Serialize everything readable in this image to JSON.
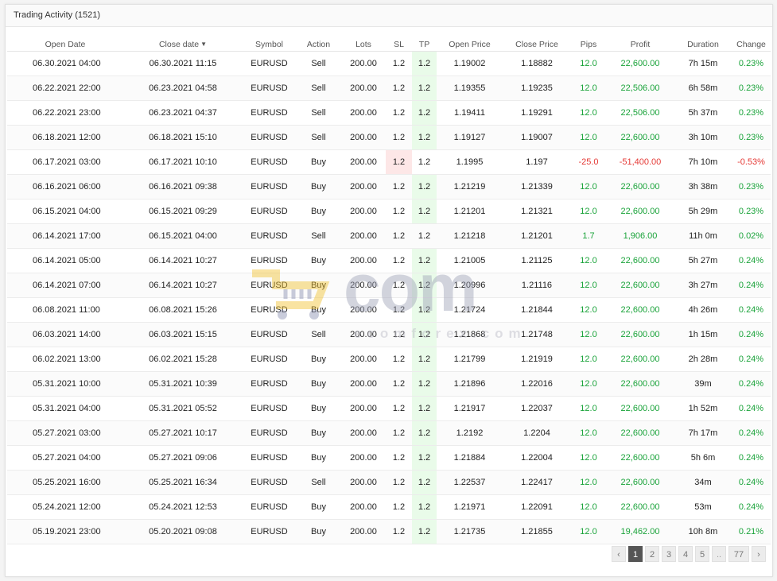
{
  "panel": {
    "title": "Trading Activity (1521)"
  },
  "table": {
    "columns": [
      "Open Date",
      "Close date",
      "Symbol",
      "Action",
      "Lots",
      "SL",
      "TP",
      "Open Price",
      "Close Price",
      "Pips",
      "Profit",
      "Duration",
      "Change"
    ],
    "sort_indicator": "▼",
    "rows": [
      {
        "open_date": "06.30.2021 04:00",
        "close_date": "06.30.2021 11:15",
        "symbol": "EURUSD",
        "action": "Sell",
        "lots": "200.00",
        "sl": "1.2",
        "tp": "1.2",
        "open_price": "1.19002",
        "close_price": "1.18882",
        "pips": "12.0",
        "profit": "22,600.00",
        "duration": "7h 15m",
        "change": "0.23%",
        "hl": "tp",
        "sign": "pos"
      },
      {
        "open_date": "06.22.2021 22:00",
        "close_date": "06.23.2021 04:58",
        "symbol": "EURUSD",
        "action": "Sell",
        "lots": "200.00",
        "sl": "1.2",
        "tp": "1.2",
        "open_price": "1.19355",
        "close_price": "1.19235",
        "pips": "12.0",
        "profit": "22,506.00",
        "duration": "6h 58m",
        "change": "0.23%",
        "hl": "tp",
        "sign": "pos"
      },
      {
        "open_date": "06.22.2021 23:00",
        "close_date": "06.23.2021 04:37",
        "symbol": "EURUSD",
        "action": "Sell",
        "lots": "200.00",
        "sl": "1.2",
        "tp": "1.2",
        "open_price": "1.19411",
        "close_price": "1.19291",
        "pips": "12.0",
        "profit": "22,506.00",
        "duration": "5h 37m",
        "change": "0.23%",
        "hl": "tp",
        "sign": "pos"
      },
      {
        "open_date": "06.18.2021 12:00",
        "close_date": "06.18.2021 15:10",
        "symbol": "EURUSD",
        "action": "Sell",
        "lots": "200.00",
        "sl": "1.2",
        "tp": "1.2",
        "open_price": "1.19127",
        "close_price": "1.19007",
        "pips": "12.0",
        "profit": "22,600.00",
        "duration": "3h 10m",
        "change": "0.23%",
        "hl": "tp",
        "sign": "pos"
      },
      {
        "open_date": "06.17.2021 03:00",
        "close_date": "06.17.2021 10:10",
        "symbol": "EURUSD",
        "action": "Buy",
        "lots": "200.00",
        "sl": "1.2",
        "tp": "1.2",
        "open_price": "1.1995",
        "close_price": "1.197",
        "pips": "-25.0",
        "profit": "-51,400.00",
        "duration": "7h 10m",
        "change": "-0.53%",
        "hl": "sl",
        "sign": "neg"
      },
      {
        "open_date": "06.16.2021 06:00",
        "close_date": "06.16.2021 09:38",
        "symbol": "EURUSD",
        "action": "Buy",
        "lots": "200.00",
        "sl": "1.2",
        "tp": "1.2",
        "open_price": "1.21219",
        "close_price": "1.21339",
        "pips": "12.0",
        "profit": "22,600.00",
        "duration": "3h 38m",
        "change": "0.23%",
        "hl": "tp",
        "sign": "pos"
      },
      {
        "open_date": "06.15.2021 04:00",
        "close_date": "06.15.2021 09:29",
        "symbol": "EURUSD",
        "action": "Buy",
        "lots": "200.00",
        "sl": "1.2",
        "tp": "1.2",
        "open_price": "1.21201",
        "close_price": "1.21321",
        "pips": "12.0",
        "profit": "22,600.00",
        "duration": "5h 29m",
        "change": "0.23%",
        "hl": "tp",
        "sign": "pos"
      },
      {
        "open_date": "06.14.2021 17:00",
        "close_date": "06.15.2021 04:00",
        "symbol": "EURUSD",
        "action": "Sell",
        "lots": "200.00",
        "sl": "1.2",
        "tp": "1.2",
        "open_price": "1.21218",
        "close_price": "1.21201",
        "pips": "1.7",
        "profit": "1,906.00",
        "duration": "11h 0m",
        "change": "0.02%",
        "hl": "none",
        "sign": "pos"
      },
      {
        "open_date": "06.14.2021 05:00",
        "close_date": "06.14.2021 10:27",
        "symbol": "EURUSD",
        "action": "Buy",
        "lots": "200.00",
        "sl": "1.2",
        "tp": "1.2",
        "open_price": "1.21005",
        "close_price": "1.21125",
        "pips": "12.0",
        "profit": "22,600.00",
        "duration": "5h 27m",
        "change": "0.24%",
        "hl": "tp",
        "sign": "pos"
      },
      {
        "open_date": "06.14.2021 07:00",
        "close_date": "06.14.2021 10:27",
        "symbol": "EURUSD",
        "action": "Buy",
        "lots": "200.00",
        "sl": "1.2",
        "tp": "1.2",
        "open_price": "1.20996",
        "close_price": "1.21116",
        "pips": "12.0",
        "profit": "22,600.00",
        "duration": "3h 27m",
        "change": "0.24%",
        "hl": "tp",
        "sign": "pos"
      },
      {
        "open_date": "06.08.2021 11:00",
        "close_date": "06.08.2021 15:26",
        "symbol": "EURUSD",
        "action": "Buy",
        "lots": "200.00",
        "sl": "1.2",
        "tp": "1.2",
        "open_price": "1.21724",
        "close_price": "1.21844",
        "pips": "12.0",
        "profit": "22,600.00",
        "duration": "4h 26m",
        "change": "0.24%",
        "hl": "tp",
        "sign": "pos"
      },
      {
        "open_date": "06.03.2021 14:00",
        "close_date": "06.03.2021 15:15",
        "symbol": "EURUSD",
        "action": "Sell",
        "lots": "200.00",
        "sl": "1.2",
        "tp": "1.2",
        "open_price": "1.21868",
        "close_price": "1.21748",
        "pips": "12.0",
        "profit": "22,600.00",
        "duration": "1h 15m",
        "change": "0.24%",
        "hl": "tp",
        "sign": "pos"
      },
      {
        "open_date": "06.02.2021 13:00",
        "close_date": "06.02.2021 15:28",
        "symbol": "EURUSD",
        "action": "Buy",
        "lots": "200.00",
        "sl": "1.2",
        "tp": "1.2",
        "open_price": "1.21799",
        "close_price": "1.21919",
        "pips": "12.0",
        "profit": "22,600.00",
        "duration": "2h 28m",
        "change": "0.24%",
        "hl": "tp",
        "sign": "pos"
      },
      {
        "open_date": "05.31.2021 10:00",
        "close_date": "05.31.2021 10:39",
        "symbol": "EURUSD",
        "action": "Buy",
        "lots": "200.00",
        "sl": "1.2",
        "tp": "1.2",
        "open_price": "1.21896",
        "close_price": "1.22016",
        "pips": "12.0",
        "profit": "22,600.00",
        "duration": "39m",
        "change": "0.24%",
        "hl": "tp",
        "sign": "pos"
      },
      {
        "open_date": "05.31.2021 04:00",
        "close_date": "05.31.2021 05:52",
        "symbol": "EURUSD",
        "action": "Buy",
        "lots": "200.00",
        "sl": "1.2",
        "tp": "1.2",
        "open_price": "1.21917",
        "close_price": "1.22037",
        "pips": "12.0",
        "profit": "22,600.00",
        "duration": "1h 52m",
        "change": "0.24%",
        "hl": "tp",
        "sign": "pos"
      },
      {
        "open_date": "05.27.2021 03:00",
        "close_date": "05.27.2021 10:17",
        "symbol": "EURUSD",
        "action": "Buy",
        "lots": "200.00",
        "sl": "1.2",
        "tp": "1.2",
        "open_price": "1.2192",
        "close_price": "1.2204",
        "pips": "12.0",
        "profit": "22,600.00",
        "duration": "7h 17m",
        "change": "0.24%",
        "hl": "tp",
        "sign": "pos"
      },
      {
        "open_date": "05.27.2021 04:00",
        "close_date": "05.27.2021 09:06",
        "symbol": "EURUSD",
        "action": "Buy",
        "lots": "200.00",
        "sl": "1.2",
        "tp": "1.2",
        "open_price": "1.21884",
        "close_price": "1.22004",
        "pips": "12.0",
        "profit": "22,600.00",
        "duration": "5h 6m",
        "change": "0.24%",
        "hl": "tp",
        "sign": "pos"
      },
      {
        "open_date": "05.25.2021 16:00",
        "close_date": "05.25.2021 16:34",
        "symbol": "EURUSD",
        "action": "Sell",
        "lots": "200.00",
        "sl": "1.2",
        "tp": "1.2",
        "open_price": "1.22537",
        "close_price": "1.22417",
        "pips": "12.0",
        "profit": "22,600.00",
        "duration": "34m",
        "change": "0.24%",
        "hl": "tp",
        "sign": "pos"
      },
      {
        "open_date": "05.24.2021 12:00",
        "close_date": "05.24.2021 12:53",
        "symbol": "EURUSD",
        "action": "Buy",
        "lots": "200.00",
        "sl": "1.2",
        "tp": "1.2",
        "open_price": "1.21971",
        "close_price": "1.22091",
        "pips": "12.0",
        "profit": "22,600.00",
        "duration": "53m",
        "change": "0.24%",
        "hl": "tp",
        "sign": "pos"
      },
      {
        "open_date": "05.19.2021 23:00",
        "close_date": "05.20.2021 09:08",
        "symbol": "EURUSD",
        "action": "Buy",
        "lots": "200.00",
        "sl": "1.2",
        "tp": "1.2",
        "open_price": "1.21735",
        "close_price": "1.21855",
        "pips": "12.0",
        "profit": "19,462.00",
        "duration": "10h 8m",
        "change": "0.21%",
        "hl": "tp",
        "sign": "pos"
      }
    ]
  },
  "pagination": {
    "prev_icon": "chevron-left-icon",
    "next_icon": "chevron-right-icon",
    "pages": [
      "1",
      "2",
      "3",
      "4",
      "5"
    ],
    "ellipsis": "..",
    "last_page": "77",
    "current": "1"
  },
  "watermark": {
    "text": "ecomforex.com",
    "word": "com"
  },
  "colors": {
    "positive": "#1aa33a",
    "negative": "#e53935",
    "tp_highlight": "#e9fbe9",
    "sl_highlight": "#fde7e7"
  }
}
